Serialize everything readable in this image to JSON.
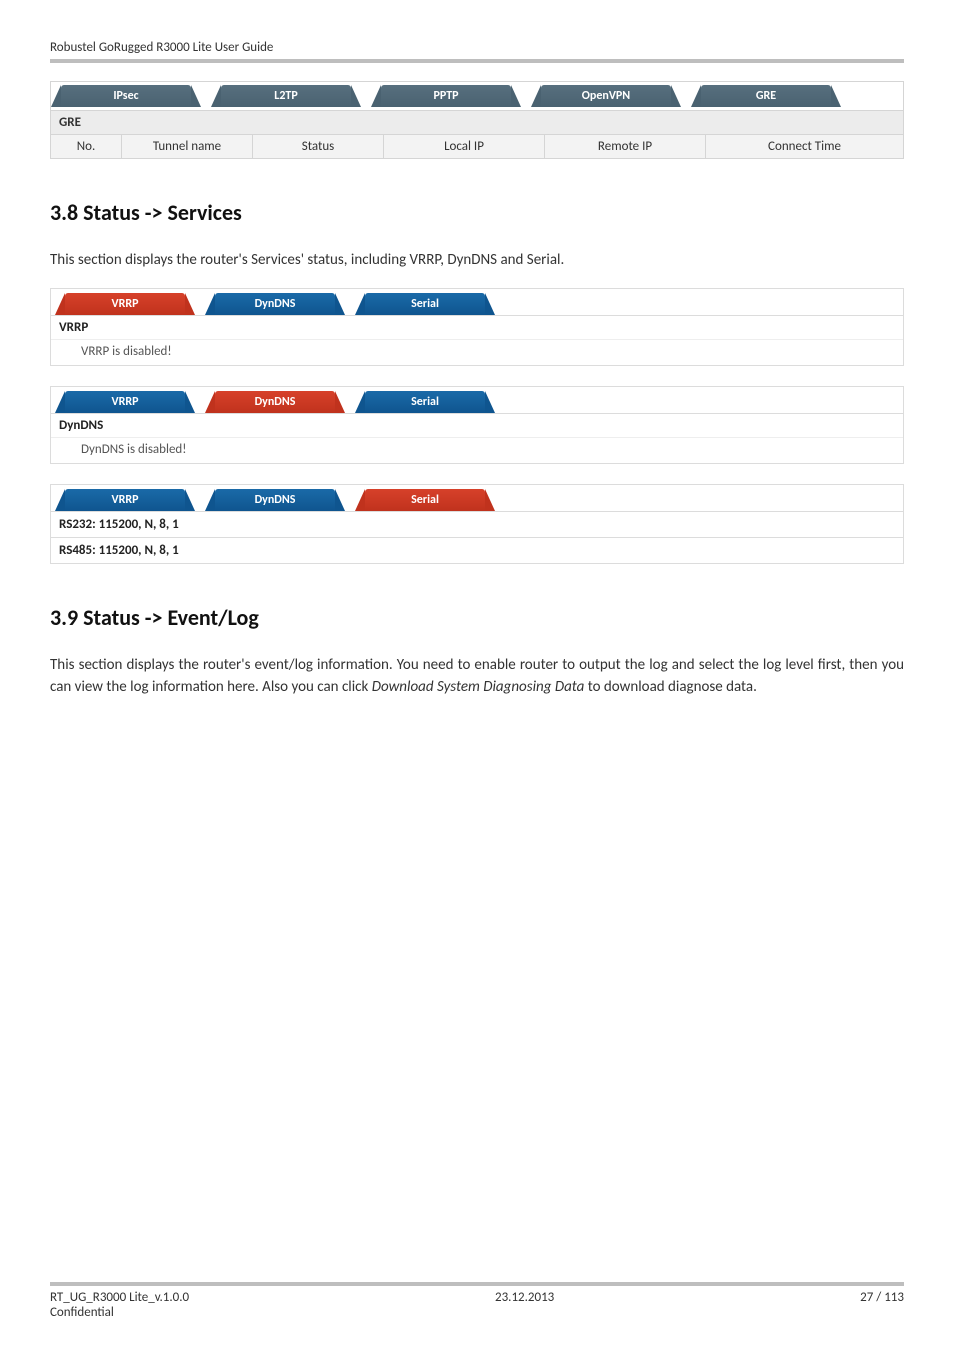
{
  "header": "Robustel GoRugged R3000 Lite User Guide",
  "footer": {
    "left": "RT_UG_R3000 Lite_v.1.0.0",
    "center": "23.12.2013",
    "right": "27 / 113",
    "conf": "Confidential"
  },
  "vpn": {
    "tabs": [
      "IPsec",
      "L2TP",
      "PPTP",
      "OpenVPN",
      "GRE"
    ],
    "gre_title": "GRE",
    "gre_headers": [
      "No.",
      "Tunnel name",
      "Status",
      "Local IP",
      "Remote IP",
      "Connect Time"
    ]
  },
  "sec38": {
    "title": "3.8    Status -> Services",
    "intro": "This section displays the router's Services' status, including VRRP, DynDNS and Serial."
  },
  "services": {
    "tabs": [
      "VRRP",
      "DynDNS",
      "Serial"
    ],
    "vrrp": {
      "title": "VRRP",
      "status": "VRRP is disabled!"
    },
    "dyndns": {
      "title": "DynDNS",
      "status": "DynDNS is disabled!"
    },
    "serial": {
      "rs232": "RS232: 115200, N, 8, 1",
      "rs485": "RS485: 115200, N, 8, 1"
    }
  },
  "sec39": {
    "title": "3.9    Status -> Event/Log",
    "intro_1": "This section displays the router's event/log information. You need to enable router to output the log and select the log level first, then you can view the log information here. Also you can click ",
    "intro_italic": "Download System Diagnosing Data",
    "intro_2": " to download diagnose data."
  }
}
